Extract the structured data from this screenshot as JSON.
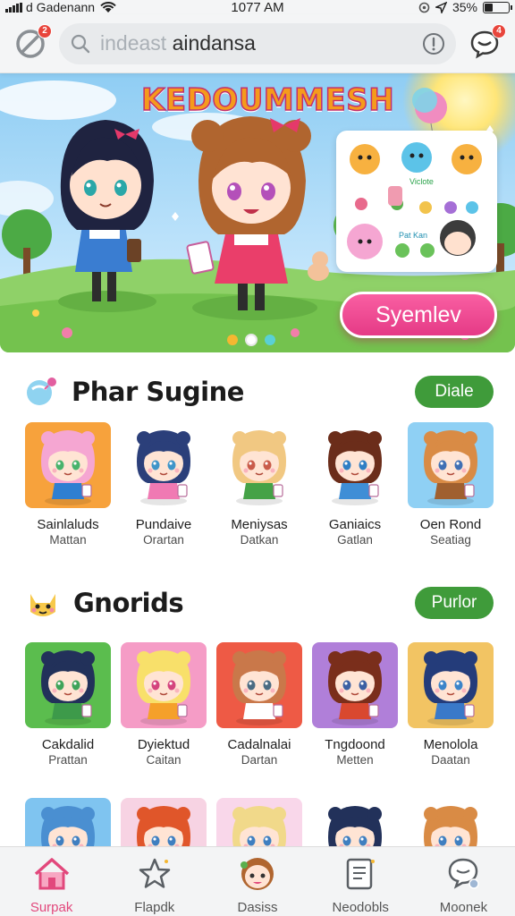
{
  "status_bar": {
    "carrier": "d Gadenann",
    "time": "1077 AM",
    "battery_text": "35%",
    "battery_level": 0.35
  },
  "header": {
    "notification_badge": "2",
    "search": {
      "value": "aindansa",
      "placeholder": "indeast"
    },
    "chat_badge": "4"
  },
  "banner": {
    "title": "KEDOUMMESH",
    "sticker_card_text": [
      "Viclote",
      "Pat Kan"
    ],
    "cta_label": "Syemlev",
    "carousel_count": 3,
    "carousel_active": 1,
    "colors": {
      "cta": "#e94b8f",
      "title": "#f59b1c"
    }
  },
  "sections": [
    {
      "title": "Phar Sugine",
      "action_label": "Diale",
      "items": [
        {
          "name": "Sainlaluds",
          "sub": "Mattan",
          "bg": "#f7a23c",
          "hair": "#f5a6d2",
          "eyes": "#48b36c",
          "outfit": "#2f7fd1"
        },
        {
          "name": "Pundaive",
          "sub": "Orartan",
          "bg": "none",
          "hair": "#2b3f7a",
          "eyes": "#3f95c9",
          "outfit": "#f07ab3"
        },
        {
          "name": "Meniysas",
          "sub": "Datkan",
          "bg": "none",
          "hair": "#f1c882",
          "eyes": "#c95b4a",
          "outfit": "#45a247"
        },
        {
          "name": "Ganiaics",
          "sub": "Gatlan",
          "bg": "none",
          "hair": "#6b2d1a",
          "eyes": "#2f7ec4",
          "outfit": "#3f8ed6"
        },
        {
          "name": "Oen Rond",
          "sub": "Seatiag",
          "bg": "#8fd0f4",
          "hair": "#d98b45",
          "eyes": "#3f6fb4",
          "outfit": "#a0602f"
        }
      ]
    },
    {
      "title": "Gnorids",
      "action_label": "Purlor",
      "items": [
        {
          "name": "Cakdalid",
          "sub": "Prattan",
          "bg": "#5bbd4e",
          "hair": "#22315a",
          "eyes": "#3fa35a",
          "outfit": "#3d9a4a"
        },
        {
          "name": "Dyiektud",
          "sub": "Caitan",
          "bg": "#f59cc6",
          "hair": "#f8e06a",
          "eyes": "#d4447e",
          "outfit": "#f5a02a"
        },
        {
          "name": "Cadalnalai",
          "sub": "Dartan",
          "bg": "#ee5a45",
          "hair": "#c9784a",
          "eyes": "#4a6b82",
          "outfit": "#ffffff"
        },
        {
          "name": "Tngdoond",
          "sub": "Metten",
          "bg": "#b07fd9",
          "hair": "#7a2e1b",
          "eyes": "#3b5fa3",
          "outfit": "#d9482f"
        },
        {
          "name": "Menolola",
          "sub": "Daatan",
          "bg": "#f2c463",
          "hair": "#243c7a",
          "eyes": "#3b84c9",
          "outfit": "#3a79c9"
        }
      ]
    }
  ],
  "third_row": [
    {
      "bg": "#7fc4f0",
      "hair": "#4a8fd1"
    },
    {
      "bg": "#f7d3e3",
      "hair": "#e0562a"
    },
    {
      "bg": "#f9d7ea",
      "hair": "#f1d98a"
    },
    {
      "bg": "none",
      "hair": "#22315a"
    },
    {
      "bg": "none",
      "hair": "#d98b45"
    }
  ],
  "bottom_nav": [
    {
      "label": "Surpak",
      "icon": "home-icon",
      "active": true
    },
    {
      "label": "Flapdk",
      "icon": "star-icon",
      "active": false
    },
    {
      "label": "Dasiss",
      "icon": "avatar-icon",
      "active": false
    },
    {
      "label": "Neodobls",
      "icon": "document-icon",
      "active": false
    },
    {
      "label": "Moonek",
      "icon": "chat-bubble-icon",
      "active": false
    }
  ]
}
